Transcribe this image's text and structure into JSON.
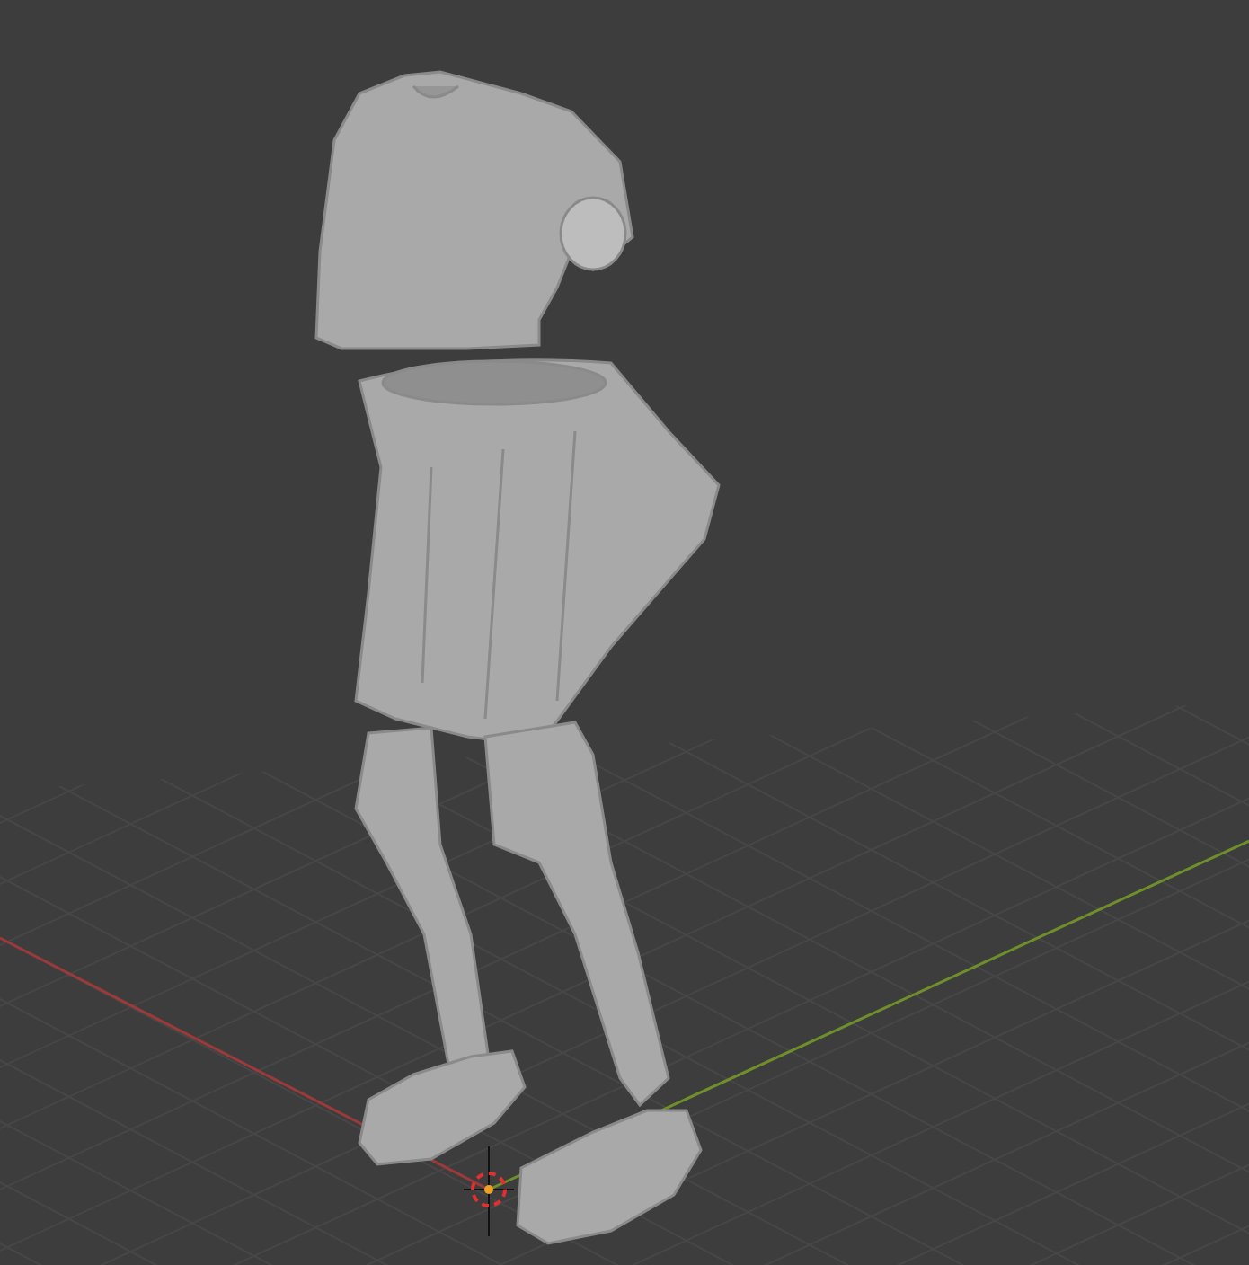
{
  "viewport": {
    "axes": [
      {
        "color": "#9a3a3a"
      },
      {
        "color": "#6f8f2a"
      }
    ]
  }
}
